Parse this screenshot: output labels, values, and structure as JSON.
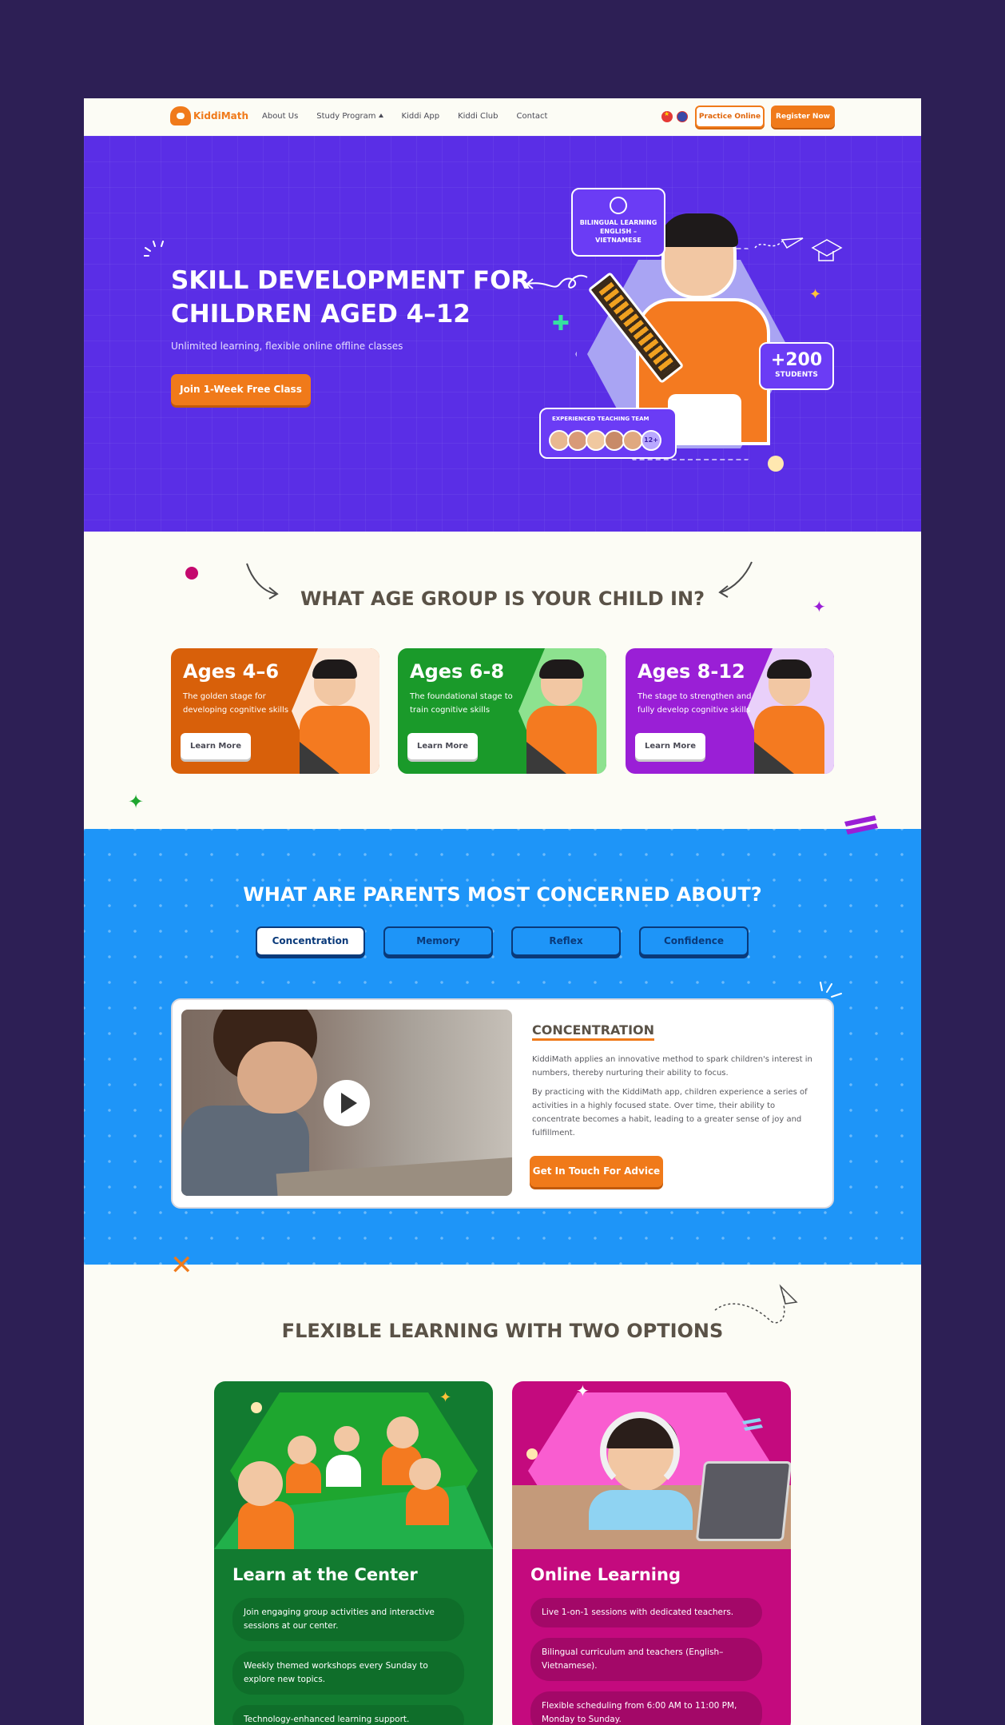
{
  "nav": {
    "logo": "KiddiMath",
    "links": [
      "About Us",
      "Study Program",
      "Kiddi App",
      "Kiddi Club",
      "Contact"
    ],
    "practice_label": "Practice Online",
    "register_label": "Register Now"
  },
  "hero": {
    "title": "SKILL DEVELOPMENT FOR CHILDREN AGED 4–12",
    "subtitle": "Unlimited learning, flexible online offline classes",
    "cta": "Join 1-Week Free Class",
    "bilingual": "BILINGUAL LEARNING ENGLISH – VIETNAMESE",
    "students_count": "+200",
    "students_label": "STUDENTS",
    "team_label": "EXPERIENCED TEACHING TEAM",
    "team_more": "12+"
  },
  "ages": {
    "title": "WHAT AGE GROUP IS YOUR CHILD IN?",
    "cards": [
      {
        "name": "Ages 4–6",
        "desc": "The golden stage for developing cognitive skills",
        "button": "Learn More"
      },
      {
        "name": "Ages 6-8",
        "desc": "The foundational stage to train cognitive skills",
        "button": "Learn More"
      },
      {
        "name": "Ages 8-12",
        "desc": "The stage to strengthen and fully develop cognitive skills",
        "button": "Learn More"
      }
    ]
  },
  "concern": {
    "title": "WHAT ARE PARENTS MOST CONCERNED ABOUT?",
    "tabs": [
      "Concentration",
      "Memory",
      "Reflex",
      "Confidence"
    ],
    "active_tab": "Concentration",
    "heading": "CONCENTRATION",
    "p1": "KiddiMath applies an innovative method to spark children's interest in numbers, thereby nurturing their ability to focus.",
    "p2": "By practicing with the KiddiMath app, children experience a series of activities in a highly focused state. Over time, their ability to concentrate becomes a habit, leading to a greater sense of joy and fulfillment.",
    "cta": "Get In Touch For Advice"
  },
  "flexible": {
    "title": "FLEXIBLE LEARNING WITH TWO OPTIONS",
    "options": [
      {
        "name": "Learn at the Center",
        "items": [
          "Join engaging group activities and interactive sessions at our center.",
          "Weekly themed workshops every Sunday to explore new topics.",
          "Technology-enhanced learning support."
        ]
      },
      {
        "name": "Online Learning",
        "items": [
          "Live 1-on-1 sessions with dedicated teachers.",
          "Bilingual curriculum and teachers (English–Vietnamese).",
          "Flexible scheduling from 6:00 AM to 11:00 PM, Monday to Sunday."
        ]
      }
    ]
  },
  "colors": {
    "background": "#2d1f55",
    "hero": "#5a2ee6",
    "accent": "#f07a1a",
    "concern": "#1e95f8",
    "age_orange": "#d8600a",
    "age_green": "#1a9a2a",
    "age_purple": "#9a1fd6",
    "option_green": "#127b30",
    "option_pink": "#c40a7e"
  }
}
